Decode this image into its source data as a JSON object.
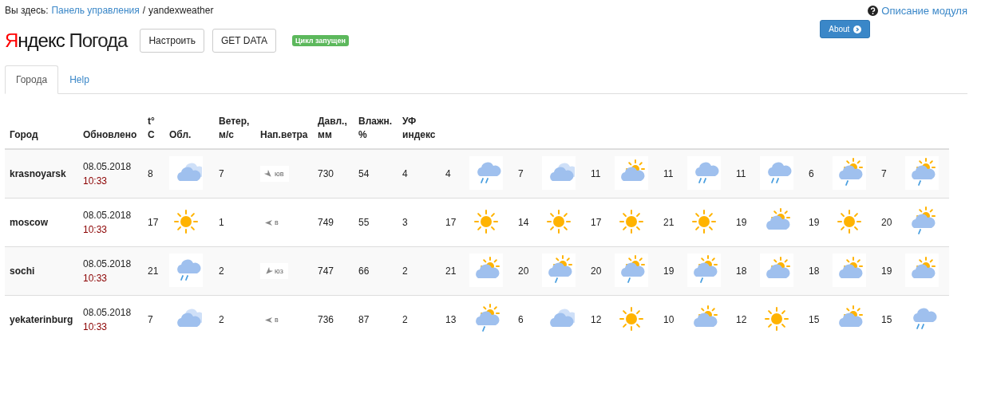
{
  "breadcrumb": {
    "prefix": "Вы здесь:",
    "link": "Панель управления",
    "separator": "/",
    "current": "yandexweather"
  },
  "help_link": "Описание модуля",
  "about_button": "About",
  "logo": {
    "initial": "Я",
    "rest": "ндекс",
    "product": "Погода"
  },
  "buttons": [
    "Настроить",
    "GET DATA"
  ],
  "status_badge": "Цикл запущен",
  "tabs": [
    {
      "label": "Города",
      "selected": true
    },
    {
      "label": "Help",
      "selected": false
    }
  ],
  "columns": [
    "Город",
    "Обновлено",
    "t° C",
    "Обл.",
    "Ветер, м/с",
    "Нап.ветра",
    "Давл., мм",
    "Влажн. %",
    "УФ индекс"
  ],
  "rows": [
    {
      "city": "krasnoyarsk",
      "date": "08.05.2018",
      "time": "10:33",
      "temp": "8",
      "sky": {
        "kind": "overcast"
      },
      "wind": "7",
      "direction": {
        "text": "юв",
        "kind": "se"
      },
      "pressure": "730",
      "humidity": "54",
      "uv": "4",
      "forecast": [
        {
          "temp": "4",
          "kind": "rain"
        },
        {
          "temp": "7",
          "kind": "overcast"
        },
        {
          "temp": "11",
          "kind": "partly"
        },
        {
          "temp": "11",
          "kind": "rain"
        },
        {
          "temp": "11",
          "kind": "rain"
        },
        {
          "temp": "6",
          "kind": "partly-rain"
        },
        {
          "temp": "7",
          "kind": "partly-rain"
        }
      ]
    },
    {
      "city": "moscow",
      "date": "08.05.2018",
      "time": "10:33",
      "temp": "17",
      "sky": {
        "kind": "sunny"
      },
      "wind": "1",
      "direction": {
        "text": "в",
        "kind": "e"
      },
      "pressure": "749",
      "humidity": "55",
      "uv": "3",
      "forecast": [
        {
          "temp": "17",
          "kind": "sunny"
        },
        {
          "temp": "14",
          "kind": "sunny"
        },
        {
          "temp": "17",
          "kind": "sunny"
        },
        {
          "temp": "21",
          "kind": "sunny"
        },
        {
          "temp": "19",
          "kind": "partly"
        },
        {
          "temp": "19",
          "kind": "sunny"
        },
        {
          "temp": "20",
          "kind": "partly-rain"
        }
      ]
    },
    {
      "city": "sochi",
      "date": "08.05.2018",
      "time": "10:33",
      "temp": "21",
      "sky": {
        "kind": "rain"
      },
      "wind": "2",
      "direction": {
        "text": "юз",
        "kind": "sw"
      },
      "pressure": "747",
      "humidity": "66",
      "uv": "2",
      "forecast": [
        {
          "temp": "21",
          "kind": "partly"
        },
        {
          "temp": "20",
          "kind": "partly-rain"
        },
        {
          "temp": "20",
          "kind": "partly-rain"
        },
        {
          "temp": "19",
          "kind": "partly-rain"
        },
        {
          "temp": "18",
          "kind": "partly"
        },
        {
          "temp": "18",
          "kind": "partly"
        },
        {
          "temp": "19",
          "kind": "partly"
        }
      ]
    },
    {
      "city": "yekaterinburg",
      "date": "08.05.2018",
      "time": "10:33",
      "temp": "7",
      "sky": {
        "kind": "overcast"
      },
      "wind": "2",
      "direction": {
        "text": "в",
        "kind": "e"
      },
      "pressure": "736",
      "humidity": "87",
      "uv": "2",
      "forecast": [
        {
          "temp": "13",
          "kind": "partly-rain"
        },
        {
          "temp": "6",
          "kind": "overcast"
        },
        {
          "temp": "12",
          "kind": "sunny"
        },
        {
          "temp": "10",
          "kind": "partly"
        },
        {
          "temp": "12",
          "kind": "sunny"
        },
        {
          "temp": "15",
          "kind": "partly"
        },
        {
          "temp": "15",
          "kind": "rain"
        }
      ]
    }
  ]
}
